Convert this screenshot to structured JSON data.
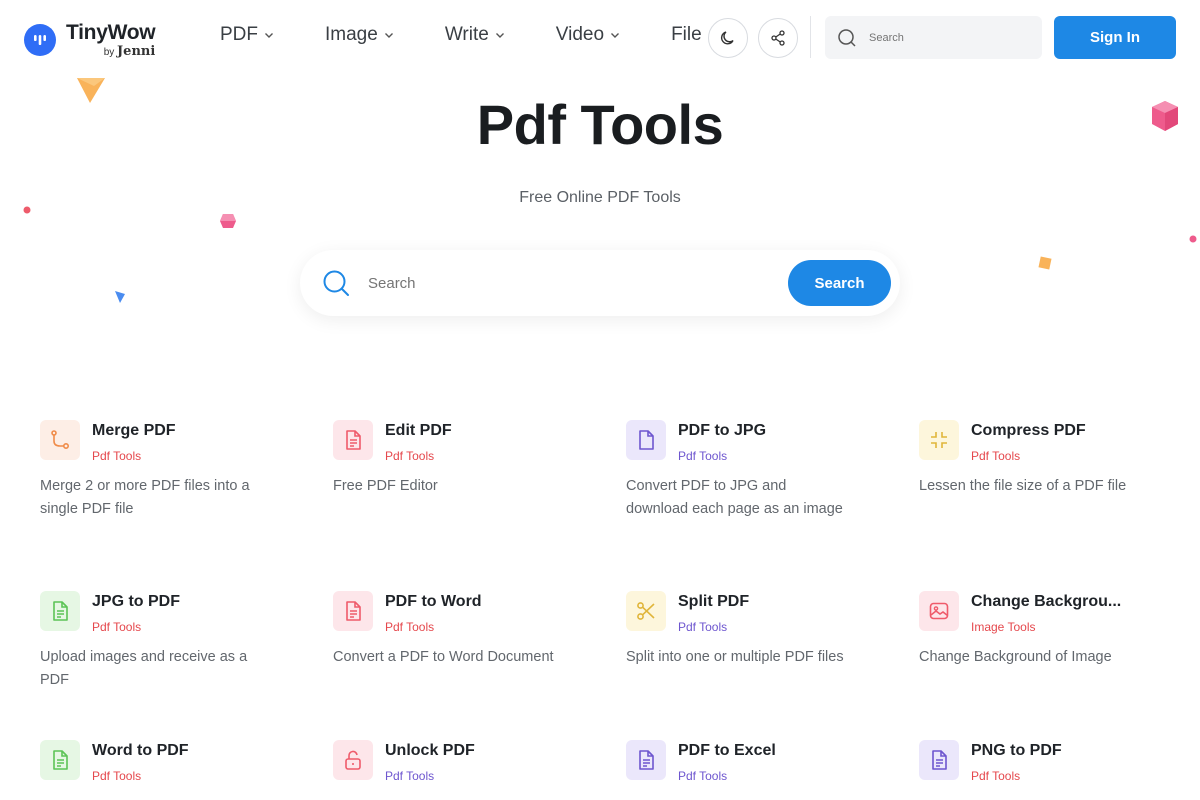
{
  "header": {
    "logo_name": "TinyWow",
    "logo_by": "by",
    "logo_by_brand": "Jenni",
    "nav": [
      {
        "label": "PDF"
      },
      {
        "label": "Image"
      },
      {
        "label": "Write"
      },
      {
        "label": "Video"
      },
      {
        "label": "File"
      }
    ],
    "search_placeholder": "Search",
    "signin_label": "Sign In"
  },
  "hero": {
    "title": "Pdf Tools",
    "subtitle": "Free Online PDF Tools",
    "search_placeholder": "Search",
    "search_button": "Search"
  },
  "colors": {
    "accent": "#1e88e5",
    "logo": "#2f6df6",
    "category_red": "#e5484d",
    "category_purple": "#6e56cf"
  },
  "tools": [
    {
      "name": "Merge PDF",
      "category": "Pdf Tools",
      "description": "Merge 2 or more PDF files into a single PDF file",
      "icon": "merge-icon",
      "icon_bg": "#fdeee6",
      "icon_color": "#f08c4a",
      "cat_color": "#e5484d"
    },
    {
      "name": "Edit PDF",
      "category": "Pdf Tools",
      "description": "Free PDF Editor",
      "icon": "document-icon",
      "icon_bg": "#fde6ea",
      "icon_color": "#ef5b6b",
      "cat_color": "#e5484d"
    },
    {
      "name": "PDF to JPG",
      "category": "Pdf Tools",
      "description": "Convert PDF to JPG and download each page as an image",
      "icon": "file-icon",
      "icon_bg": "#ebe7fb",
      "icon_color": "#6e56cf",
      "cat_color": "#6e56cf"
    },
    {
      "name": "Compress PDF",
      "category": "Pdf Tools",
      "description": "Lessen the file size of a PDF file",
      "icon": "compress-icon",
      "icon_bg": "#fdf6dc",
      "icon_color": "#e0b53a",
      "cat_color": "#e5484d"
    },
    {
      "name": "JPG to PDF",
      "category": "Pdf Tools",
      "description": "Upload images and receive as a PDF",
      "icon": "document-icon",
      "icon_bg": "#e6f7e4",
      "icon_color": "#5cc456",
      "cat_color": "#e5484d"
    },
    {
      "name": "PDF to Word",
      "category": "Pdf Tools",
      "description": "Convert a PDF to Word Document",
      "icon": "document-icon",
      "icon_bg": "#fde6ea",
      "icon_color": "#ef5b6b",
      "cat_color": "#e5484d"
    },
    {
      "name": "Split PDF",
      "category": "Pdf Tools",
      "description": "Split into one or multiple PDF files",
      "icon": "scissors-icon",
      "icon_bg": "#fdf6dc",
      "icon_color": "#e0b53a",
      "cat_color": "#6e56cf"
    },
    {
      "name": "Change Backgrou...",
      "category": "Image Tools",
      "description": "Change Background of Image",
      "icon": "image-icon",
      "icon_bg": "#fde6ea",
      "icon_color": "#ef5b6b",
      "cat_color": "#e5484d"
    },
    {
      "name": "Word to PDF",
      "category": "Pdf Tools",
      "description": "",
      "icon": "document-icon",
      "icon_bg": "#e6f7e4",
      "icon_color": "#5cc456",
      "cat_color": "#e5484d"
    },
    {
      "name": "Unlock PDF",
      "category": "Pdf Tools",
      "description": "",
      "icon": "unlock-icon",
      "icon_bg": "#fde6ea",
      "icon_color": "#ef5b6b",
      "cat_color": "#6e56cf"
    },
    {
      "name": "PDF to Excel",
      "category": "Pdf Tools",
      "description": "",
      "icon": "document-icon",
      "icon_bg": "#ebe7fb",
      "icon_color": "#6e56cf",
      "cat_color": "#6e56cf"
    },
    {
      "name": "PNG to PDF",
      "category": "Pdf Tools",
      "description": "",
      "icon": "document-icon",
      "icon_bg": "#ebe7fb",
      "icon_color": "#6e56cf",
      "cat_color": "#e5484d"
    }
  ]
}
